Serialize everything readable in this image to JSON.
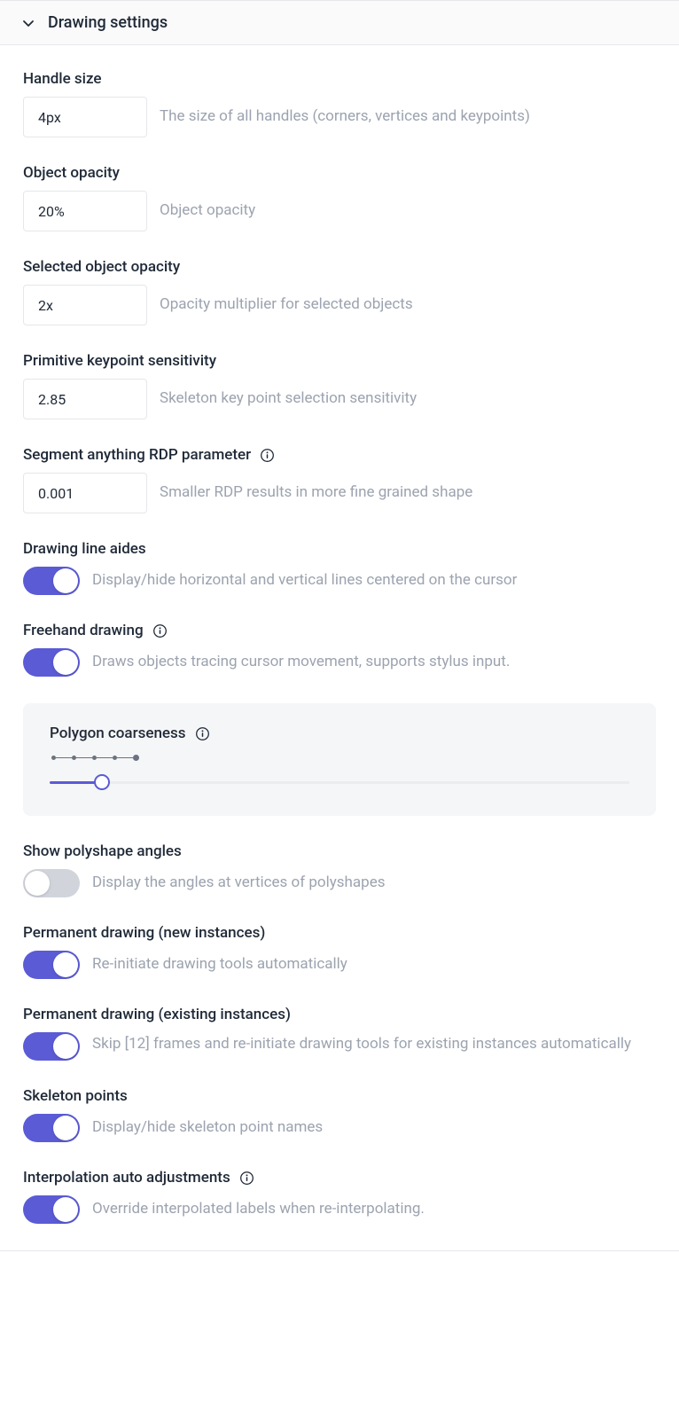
{
  "header": {
    "title": "Drawing settings"
  },
  "settings": {
    "handleSize": {
      "label": "Handle size",
      "value": "4px",
      "hint": "The size of all handles (corners, vertices and keypoints)"
    },
    "objectOpacity": {
      "label": "Object opacity",
      "value": "20%",
      "hint": "Object opacity"
    },
    "selectedOpacity": {
      "label": "Selected object opacity",
      "value": "2x",
      "hint": "Opacity multiplier for selected objects"
    },
    "keypointSensitivity": {
      "label": "Primitive keypoint sensitivity",
      "value": "2.85",
      "hint": "Skeleton key point selection sensitivity"
    },
    "rdp": {
      "label": "Segment anything RDP parameter",
      "value": "0.001",
      "hint": "Smaller RDP results in more fine grained shape"
    },
    "lineAides": {
      "label": "Drawing line aides",
      "hint": "Display/hide horizontal and vertical lines centered on the cursor",
      "on": true
    },
    "freehand": {
      "label": "Freehand drawing",
      "hint": "Draws objects tracing cursor movement, supports stylus input.",
      "on": true
    },
    "coarseness": {
      "label": "Polygon coarseness"
    },
    "polyAngles": {
      "label": "Show polyshape angles",
      "hint": "Display the angles at vertices of polyshapes",
      "on": false
    },
    "permNew": {
      "label": "Permanent drawing (new instances)",
      "hint": "Re-initiate drawing tools automatically",
      "on": true
    },
    "permExisting": {
      "label": "Permanent drawing (existing instances)",
      "hint": "Skip [12] frames and re-initiate drawing tools for existing instances automatically",
      "on": true
    },
    "skeletonPoints": {
      "label": "Skeleton points",
      "hint": "Display/hide skeleton point names",
      "on": true
    },
    "interpAuto": {
      "label": "Interpolation auto adjustments",
      "hint": "Override interpolated labels when re-interpolating.",
      "on": true
    }
  }
}
